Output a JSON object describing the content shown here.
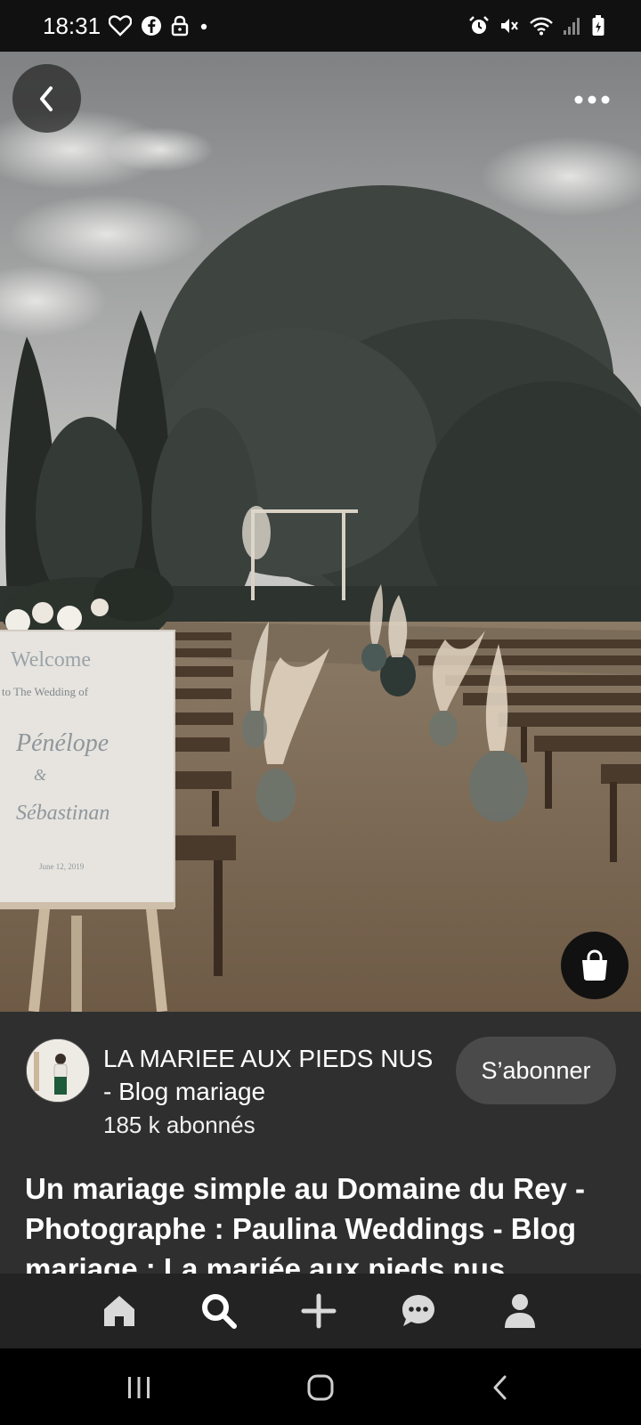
{
  "status_bar": {
    "time": "18:31",
    "left_icons": [
      "heart-outline-icon",
      "facebook-icon",
      "lock-icon",
      "dot-icon"
    ],
    "right_icons": [
      "alarm-icon",
      "mute-icon",
      "wifi-icon",
      "signal-icon",
      "battery-icon"
    ]
  },
  "photo": {
    "sign_lines": [
      "Welcome",
      "to The Wedding of",
      "Pénélope",
      "&",
      "Sébastinan",
      "June 12, 2019"
    ]
  },
  "creator": {
    "name": "LA MARIEE AUX PIEDS NUS - Blog mariage",
    "followers": "185 k abonnés",
    "follow_label": "S’abonner"
  },
  "pin": {
    "title": "Un mariage simple au Domaine du Rey - Photographe : Paulina Weddings - Blog mariage : La mariée aux pieds nus"
  },
  "bottom_nav": {
    "items": [
      "home-icon",
      "search-icon",
      "add-icon",
      "messages-icon",
      "profile-icon"
    ],
    "active": "search-icon"
  },
  "colors": {
    "background": "#2f2f2f",
    "status_bar": "#111111",
    "nav_bar": "#232323",
    "button": "#4a4a4a"
  }
}
